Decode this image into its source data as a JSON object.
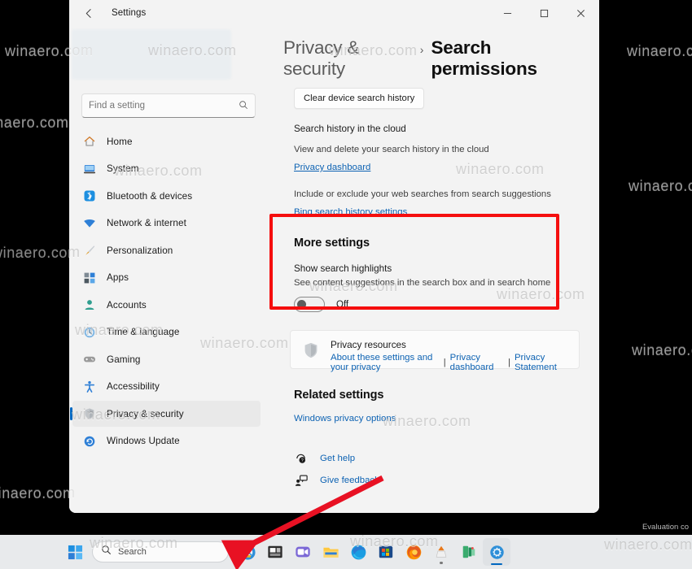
{
  "window": {
    "title": "Settings",
    "back_icon": "back-arrow-icon",
    "minimize_label": "Minimize",
    "maximize_label": "Maximize",
    "close_label": "Close"
  },
  "sidebar": {
    "search_placeholder": "Find a setting",
    "search_value": "",
    "search_icon": "search-icon",
    "items": [
      {
        "label": "Home",
        "icon": "home-icon",
        "active": false
      },
      {
        "label": "System",
        "icon": "system-icon",
        "active": false
      },
      {
        "label": "Bluetooth & devices",
        "icon": "bluetooth-icon",
        "active": false
      },
      {
        "label": "Network & internet",
        "icon": "wifi-icon",
        "active": false
      },
      {
        "label": "Personalization",
        "icon": "brush-icon",
        "active": false
      },
      {
        "label": "Apps",
        "icon": "apps-icon",
        "active": false
      },
      {
        "label": "Accounts",
        "icon": "account-icon",
        "active": false
      },
      {
        "label": "Time & language",
        "icon": "clock-icon",
        "active": false
      },
      {
        "label": "Gaming",
        "icon": "gamepad-icon",
        "active": false
      },
      {
        "label": "Accessibility",
        "icon": "accessibility-icon",
        "active": false
      },
      {
        "label": "Privacy & security",
        "icon": "shield-icon",
        "active": true
      },
      {
        "label": "Windows Update",
        "icon": "update-icon",
        "active": false
      }
    ]
  },
  "main": {
    "breadcrumb_prev": "Privacy & security",
    "breadcrumb_sep": "›",
    "breadcrumb_current": "Search permissions",
    "clear_history_button": "Clear device search history",
    "cloud_section_title": "Search history in the cloud",
    "cloud_desc": "View and delete your search history in the cloud",
    "cloud_link": "Privacy dashboard",
    "bing_desc": "Include or exclude your web searches from search suggestions",
    "bing_link": "Bing search history settings",
    "more_settings_title": "More settings",
    "highlights_label": "Show search highlights",
    "highlights_desc": "See content suggestions in the search box and in search home",
    "highlights_toggle_state": "Off",
    "resources_icon": "shield-icon",
    "resources_title": "Privacy resources",
    "resources_link_1": "About these settings and your privacy",
    "resources_divider": "|",
    "resources_link_2": "Privacy dashboard",
    "resources_link_3": "Privacy Statement",
    "related_title": "Related settings",
    "related_link": "Windows privacy options",
    "get_help": "Get help",
    "get_help_icon": "help-question-icon",
    "give_feedback": "Give feedback",
    "give_feedback_icon": "feedback-icon"
  },
  "taskbar": {
    "start_icon": "windows-start-icon",
    "search_placeholder": "Search",
    "search_icon": "search-icon",
    "items": [
      {
        "name": "copilot-icon"
      },
      {
        "name": "task-view-icon"
      },
      {
        "name": "teams-chat-icon"
      },
      {
        "name": "file-explorer-icon"
      },
      {
        "name": "microsoft-edge-icon"
      },
      {
        "name": "microsoft-store-icon"
      },
      {
        "name": "firefox-icon"
      },
      {
        "name": "vlc-icon"
      },
      {
        "name": "paint-icon"
      },
      {
        "name": "calculator-icon"
      },
      {
        "name": "settings-icon"
      }
    ]
  },
  "annotations": {
    "highlight_box_color": "#f50e0e",
    "arrow_color": "#e81123",
    "evaluation_text": "Evaluation co"
  },
  "watermark": {
    "text": "winaero.com"
  },
  "colors": {
    "accent": "#0067c0",
    "link": "#0e63b3",
    "window_bg": "#f3f3f3",
    "taskbar_bg": "#e8eaec",
    "highlight_red": "#f50e0e"
  }
}
